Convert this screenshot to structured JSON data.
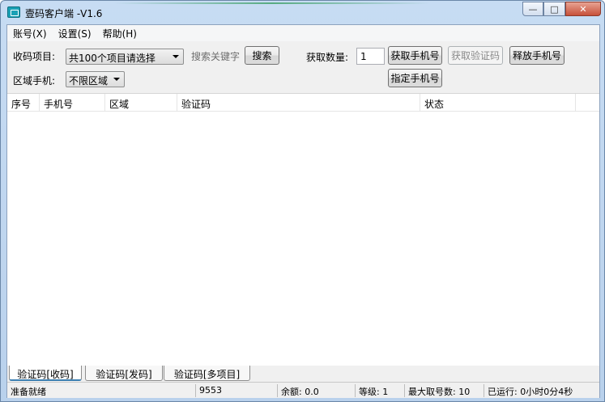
{
  "window": {
    "title": "壹码客户端 -V1.6",
    "controls": {
      "minimize": "—",
      "maximize": "□",
      "close": "✕"
    }
  },
  "menu": [
    "账号(X)",
    "设置(S)",
    "帮助(H)"
  ],
  "toolbar": {
    "project_label": "收码项目:",
    "project_value": "共100个项目请选择",
    "search_placeholder": "搜索关键字",
    "search_button": "搜索",
    "quantity_label": "获取数量:",
    "quantity_value": "1",
    "get_phone_button": "获取手机号",
    "get_code_button": "获取验证码",
    "release_phone_button": "释放手机号",
    "assign_phone_button": "指定手机号",
    "region_label": "区域手机:",
    "region_value": "不限区域"
  },
  "table": {
    "columns": [
      "序号",
      "手机号",
      "区域",
      "验证码",
      "状态"
    ],
    "rows": []
  },
  "tabs": [
    "验证码[收码]",
    "验证码[发码]",
    "验证码[多项目]"
  ],
  "status": {
    "message": "准备就绪",
    "id": "9553",
    "balance": "余额: 0.0",
    "level": "等级: 1",
    "max_numbers": "最大取号数: 10",
    "runtime": "已运行: 0小时0分4秒"
  }
}
